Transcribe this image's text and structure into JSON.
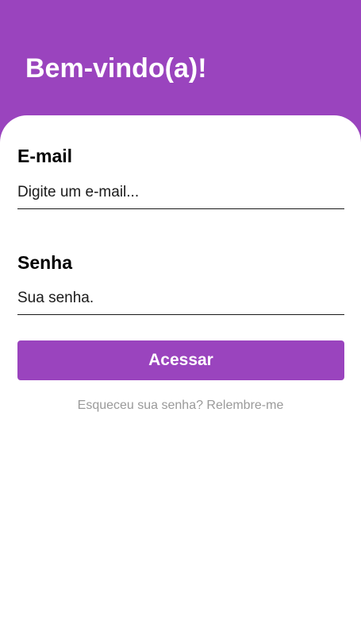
{
  "header": {
    "title": "Bem-vindo(a)!"
  },
  "form": {
    "email": {
      "label": "E-mail",
      "placeholder": "Digite um e-mail..."
    },
    "password": {
      "label": "Senha",
      "placeholder": "Sua senha."
    },
    "submit_label": "Acessar",
    "forgot_link": "Esqueceu sua senha? Relembre-me"
  },
  "colors": {
    "brand": "#9a44be",
    "background": "#ffffff",
    "link_text": "#9a9a9a"
  }
}
